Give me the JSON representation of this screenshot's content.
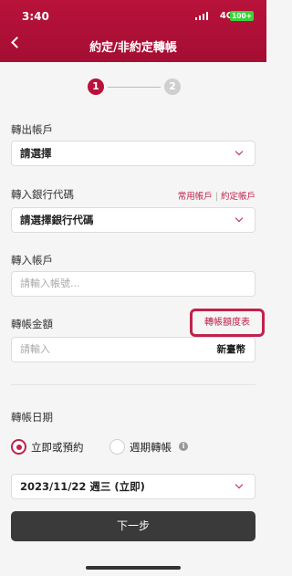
{
  "status_bar": {
    "time": "3:40",
    "network": "4G",
    "battery": "100+"
  },
  "header": {
    "title": "約定/非約定轉帳"
  },
  "steps": {
    "current": "1",
    "next": "2"
  },
  "from_account": {
    "label": "轉出帳戶",
    "value": "請選擇"
  },
  "bank_code": {
    "label": "轉入銀行代碼",
    "value": "請選擇銀行代碼",
    "link_common": "常用帳戶",
    "link_separator": "|",
    "link_designated": "約定帳戶"
  },
  "to_account": {
    "label": "轉入帳戶",
    "placeholder": "請輸入帳號..."
  },
  "amount": {
    "label": "轉帳金額",
    "placeholder": "請輸入",
    "currency": "新臺幣",
    "limit_link": "轉帳額度表"
  },
  "transfer_date": {
    "label": "轉帳日期",
    "option_immediate": "立即或預約",
    "option_recurring": "週期轉帳",
    "selected": "立即或預約",
    "date_value": "2023/11/22 週三 (立即)"
  },
  "footer": {
    "next_label": "下一步"
  },
  "icons": {
    "back": "back-arrow-icon",
    "info": "info-icon",
    "chevron": "chevron-down-icon"
  },
  "colors": {
    "brand": "#b8123a",
    "accent": "#c0224a",
    "button": "#3a3a3a"
  }
}
